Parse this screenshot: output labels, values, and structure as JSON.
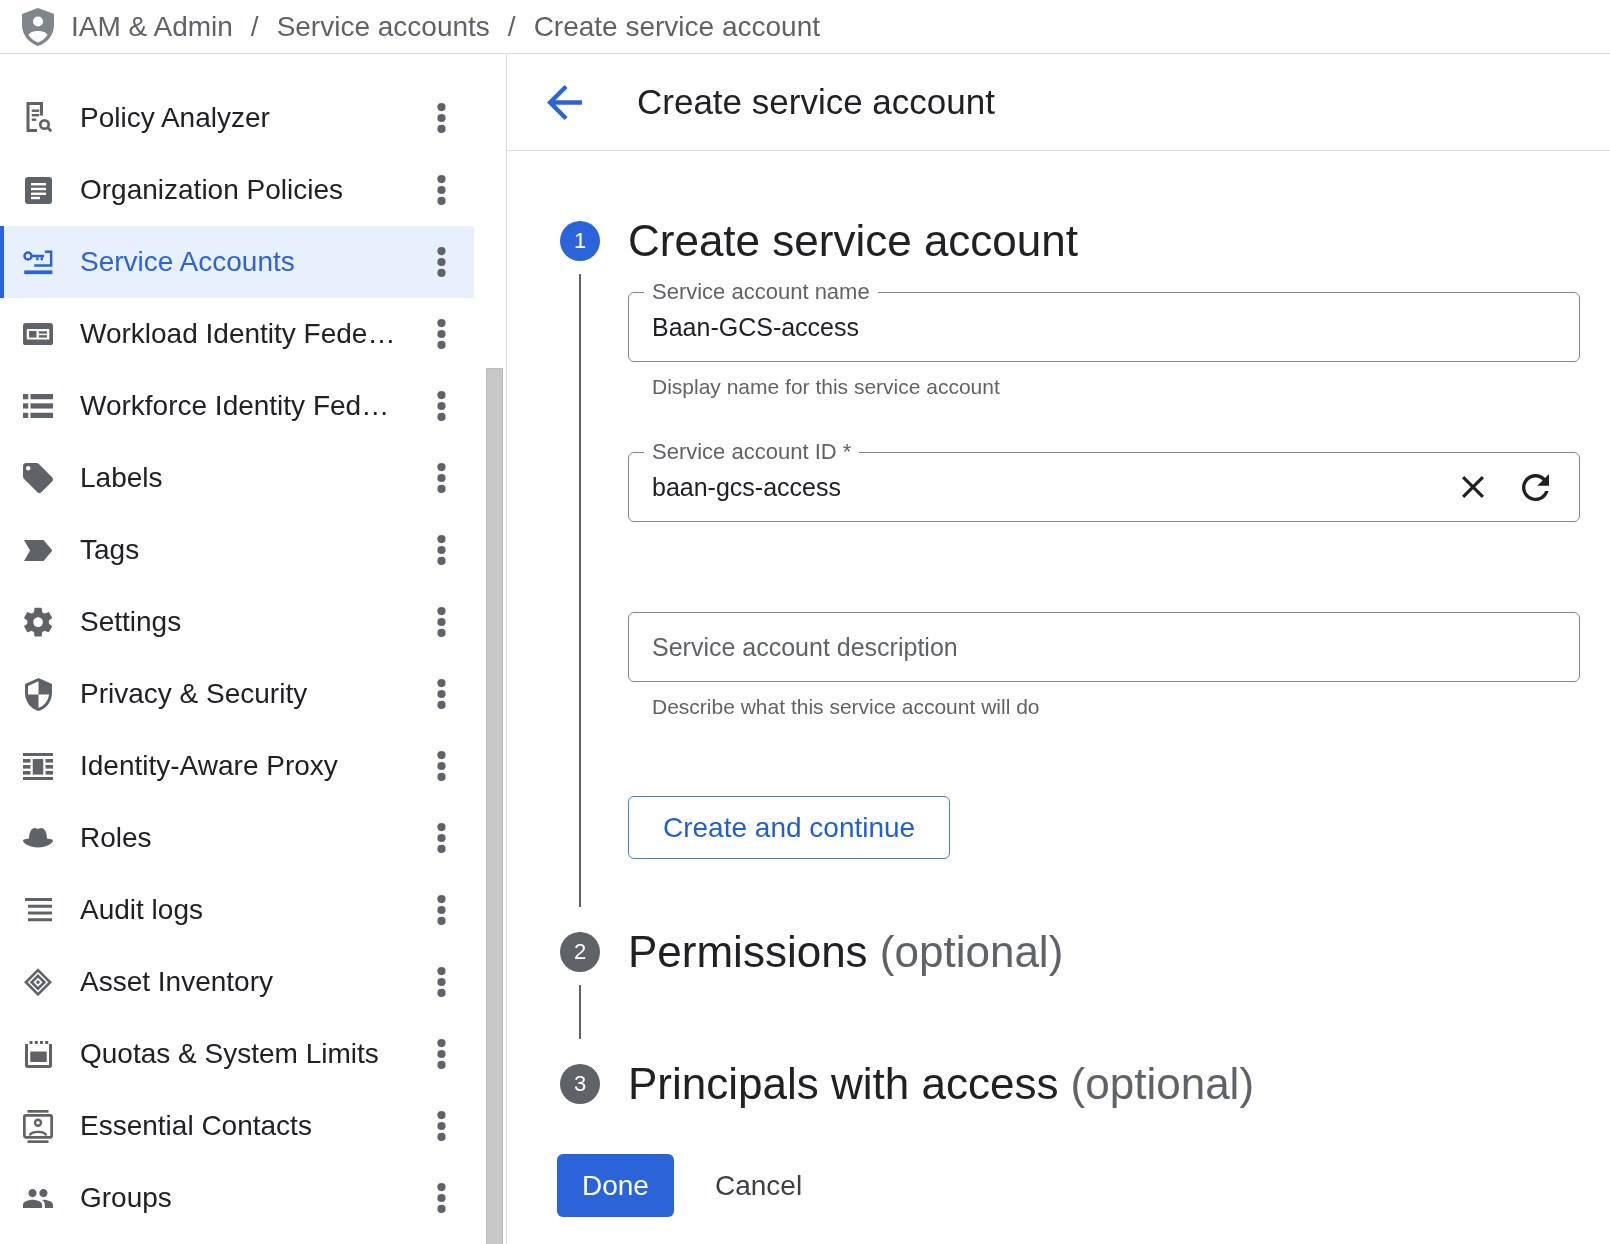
{
  "top_bar": {
    "breadcrumb": [
      {
        "kind": "link",
        "label": "IAM & Admin"
      },
      {
        "kind": "separator",
        "label": "/"
      },
      {
        "kind": "link",
        "label": "Service accounts"
      },
      {
        "kind": "separator",
        "label": "/"
      },
      {
        "kind": "current",
        "label": "Create service account"
      }
    ]
  },
  "sidebar": {
    "items": [
      {
        "label": "Policy Analyzer",
        "selected": false
      },
      {
        "label": "Organization Policies",
        "selected": false
      },
      {
        "label": "Service Accounts",
        "selected": true
      },
      {
        "label": "Workload Identity Fede…",
        "selected": false
      },
      {
        "label": "Workforce Identity Fed…",
        "selected": false
      },
      {
        "label": "Labels",
        "selected": false
      },
      {
        "label": "Tags",
        "selected": false
      },
      {
        "label": "Settings",
        "selected": false
      },
      {
        "label": "Privacy & Security",
        "selected": false
      },
      {
        "label": "Identity-Aware Proxy",
        "selected": false
      },
      {
        "label": "Roles",
        "selected": false
      },
      {
        "label": "Audit logs",
        "selected": false
      },
      {
        "label": "Asset Inventory",
        "selected": false
      },
      {
        "label": "Quotas & System Limits",
        "selected": false
      },
      {
        "label": "Essential Contacts",
        "selected": false
      },
      {
        "label": "Groups",
        "selected": false
      }
    ]
  },
  "header": {
    "title": "Create service account"
  },
  "steps": [
    {
      "number": "1",
      "title": "Create service account",
      "active": true,
      "fields": [
        {
          "kind": "text",
          "label": "Service account name",
          "value": "Baan-GCS-access",
          "helper": "Display name for this service account"
        },
        {
          "kind": "text-actions",
          "label": "Service account ID *",
          "value": "baan-gcs-access"
        },
        {
          "kind": "text",
          "placeholder": "Service account description",
          "helper": "Describe what this service account will do"
        }
      ],
      "action": "Create and continue"
    },
    {
      "number": "2",
      "title": "Permissions",
      "note": "(optional)",
      "active": false
    },
    {
      "number": "3",
      "title": "Principals with access",
      "note": "(optional)",
      "active": false
    }
  ],
  "buttons": [
    {
      "kind": "primary",
      "label": "Done"
    },
    {
      "kind": "text",
      "label": "Cancel"
    }
  ]
}
